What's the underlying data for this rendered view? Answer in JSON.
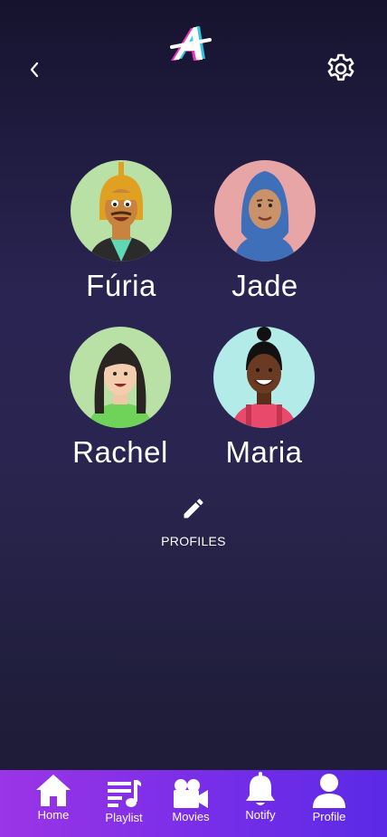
{
  "header": {
    "back_icon": "chevron-left-icon",
    "logo": "app-logo-A",
    "settings_icon": "gear-icon"
  },
  "profiles": [
    {
      "name": "Fúria",
      "avatar_bg": "#b9e0a5"
    },
    {
      "name": "Jade",
      "avatar_bg": "#e8a5a5"
    },
    {
      "name": "Rachel",
      "avatar_bg": "#b9e0a5"
    },
    {
      "name": "Maria",
      "avatar_bg": "#b3ebe8"
    }
  ],
  "edit_profiles": {
    "label": "PROFILES",
    "icon": "pencil-icon"
  },
  "bottom_nav": [
    {
      "label": "Home",
      "icon": "home-icon"
    },
    {
      "label": "Playlist",
      "icon": "playlist-icon"
    },
    {
      "label": "Movies",
      "icon": "video-camera-icon"
    },
    {
      "label": "Notify",
      "icon": "bell-icon"
    },
    {
      "label": "Profile",
      "icon": "user-icon"
    }
  ],
  "colors": {
    "nav_gradient_start": "#9b35e6",
    "nav_gradient_end": "#5a2ae6",
    "background": "#2a2452"
  }
}
